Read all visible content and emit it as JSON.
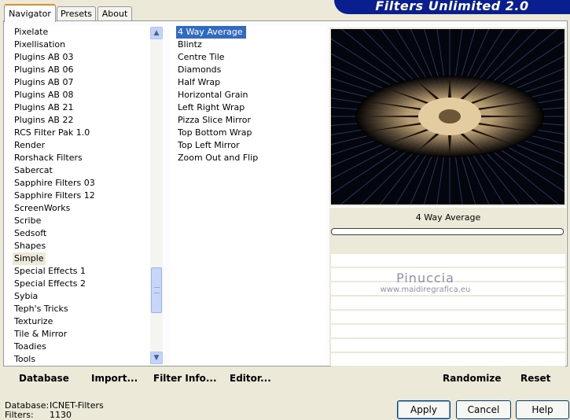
{
  "tabs": [
    {
      "label": "Navigator",
      "active": true
    },
    {
      "label": "Presets",
      "active": false
    },
    {
      "label": "About",
      "active": false
    }
  ],
  "banner_title": "Filters Unlimited 2.0",
  "categories": [
    "Pixelate",
    "Pixellisation",
    "Plugins AB 03",
    "Plugins AB 06",
    "Plugins AB 07",
    "Plugins AB 08",
    "Plugins AB 21",
    "Plugins AB 22",
    "RCS Filter Pak 1.0",
    "Render",
    "Rorshack Filters",
    "Sabercat",
    "Sapphire Filters 03",
    "Sapphire Filters 12",
    "ScreenWorks",
    "Scribe",
    "Sedsoft",
    "Shapes",
    "Simple",
    "Special Effects 1",
    "Special Effects 2",
    "Sybia",
    "Teph's Tricks",
    "Texturize",
    "Tile & Mirror",
    "Toadies",
    "Tools"
  ],
  "selected_category": "Simple",
  "filters": [
    "4 Way Average",
    "Blintz",
    "Centre Tile",
    "Diamonds",
    "Half Wrap",
    "Horizontal Grain",
    "Left Right Wrap",
    "Pizza Slice Mirror",
    "Top Bottom Wrap",
    "Top Left Mirror",
    "Zoom Out and Flip"
  ],
  "selected_filter": "4 Way Average",
  "preview": {
    "filter_name": "4 Way Average",
    "progress": 0
  },
  "watermark": {
    "name": "Pinuccia",
    "site": "www.maidiregrafica.eu"
  },
  "toolbar": {
    "database": "Database",
    "import": "Import...",
    "filter_info": "Filter Info...",
    "editor": "Editor...",
    "randomize": "Randomize",
    "reset": "Reset"
  },
  "status": {
    "database_label": "Database:",
    "database_value": "ICNET-Filters",
    "filters_label": "Filters:",
    "filters_value": "1130"
  },
  "dialog": {
    "apply": "Apply",
    "cancel": "Cancel",
    "help": "Help"
  },
  "icons": {
    "scroll_up": "chevron-up-icon",
    "scroll_down": "chevron-down-icon",
    "grip": "scroll-grip-icon"
  },
  "colors": {
    "banner": "#0a1f8f",
    "selection": "#316ac5",
    "tab_accent": "#e68b2c"
  }
}
